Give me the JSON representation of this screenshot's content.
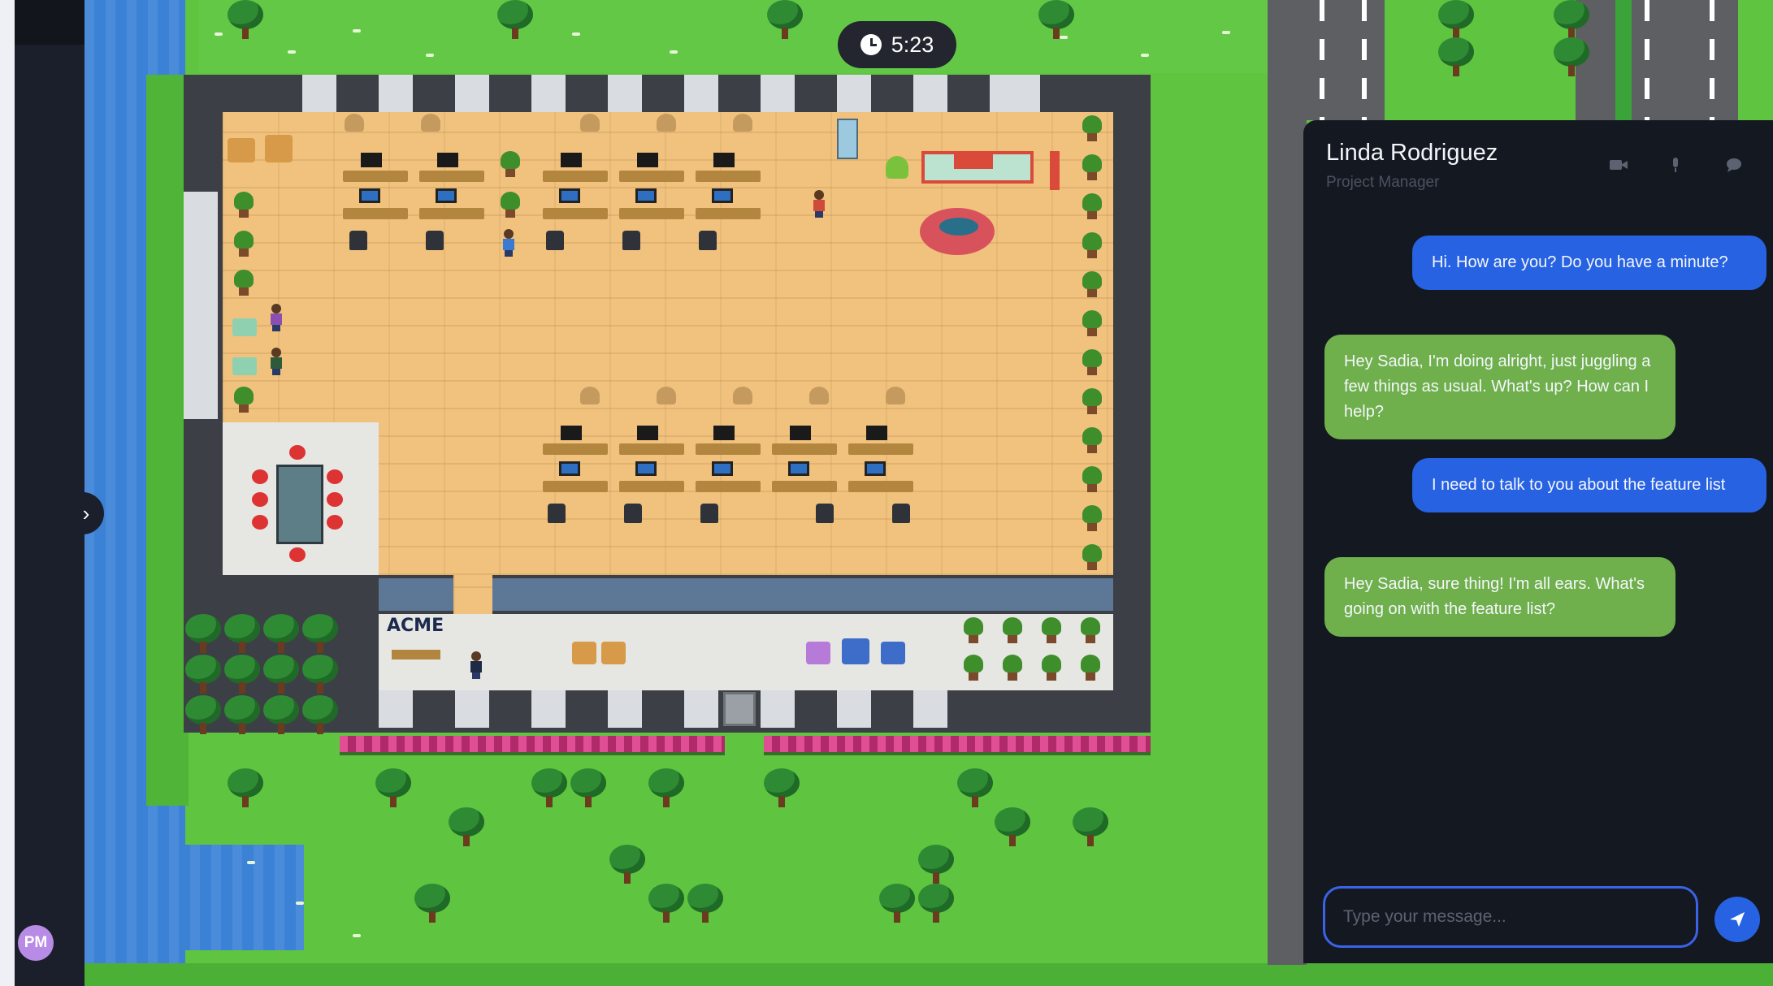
{
  "timer": {
    "value": "5:23",
    "icon": "clock-icon"
  },
  "sidebar": {
    "avatar_initials": "PM",
    "collapse_icon": "chevron-right-icon"
  },
  "map": {
    "sign_text": "ACME"
  },
  "chat": {
    "contact_name": "Linda Rodriguez",
    "contact_role": "Project Manager",
    "header_icons": [
      "video-camera-icon",
      "microphone-icon",
      "chat-bubble-icon"
    ],
    "messages": [
      {
        "direction": "outgoing",
        "text": "Hi. How are you? Do you have a minute?"
      },
      {
        "direction": "incoming",
        "text": "Hey Sadia, I'm doing alright, just juggling a few things as usual. What's up? How can I help?"
      },
      {
        "direction": "outgoing",
        "text": "I need to talk to you about the feature list"
      },
      {
        "direction": "incoming",
        "text": "Hey Sadia, sure thing! I'm all ears. What's going on with the feature list?"
      }
    ],
    "input_placeholder": "Type your message...",
    "input_value": "",
    "send_icon": "send-icon"
  },
  "colors": {
    "outgoing_bubble": "#2762e3",
    "incoming_bubble": "#6fb04d",
    "panel_background": "#141821"
  }
}
